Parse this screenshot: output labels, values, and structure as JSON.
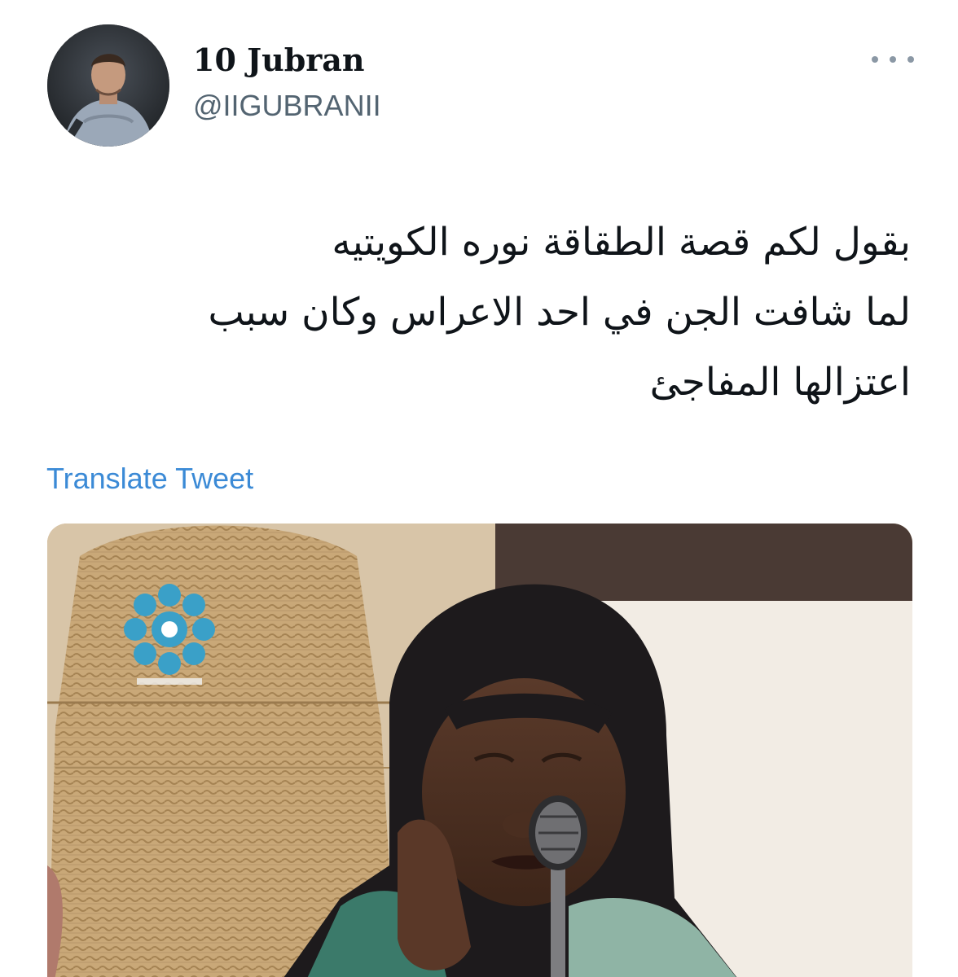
{
  "tweet": {
    "author": {
      "display_name": "10 Jubran",
      "handle": "@IIGUBRANII"
    },
    "text_lines": [
      "بقول لكم قصة الطقاقة نوره الكويتيه",
      "لما شافت الجن في احد الاعراس وكان سبب",
      "اعتزالها المفاجئ"
    ],
    "translate_label": "Translate Tweet",
    "more_icon": "more-horizontal-icon",
    "colors": {
      "link": "#3b8ad6",
      "text": "#0f1419",
      "secondary": "#536471"
    }
  }
}
